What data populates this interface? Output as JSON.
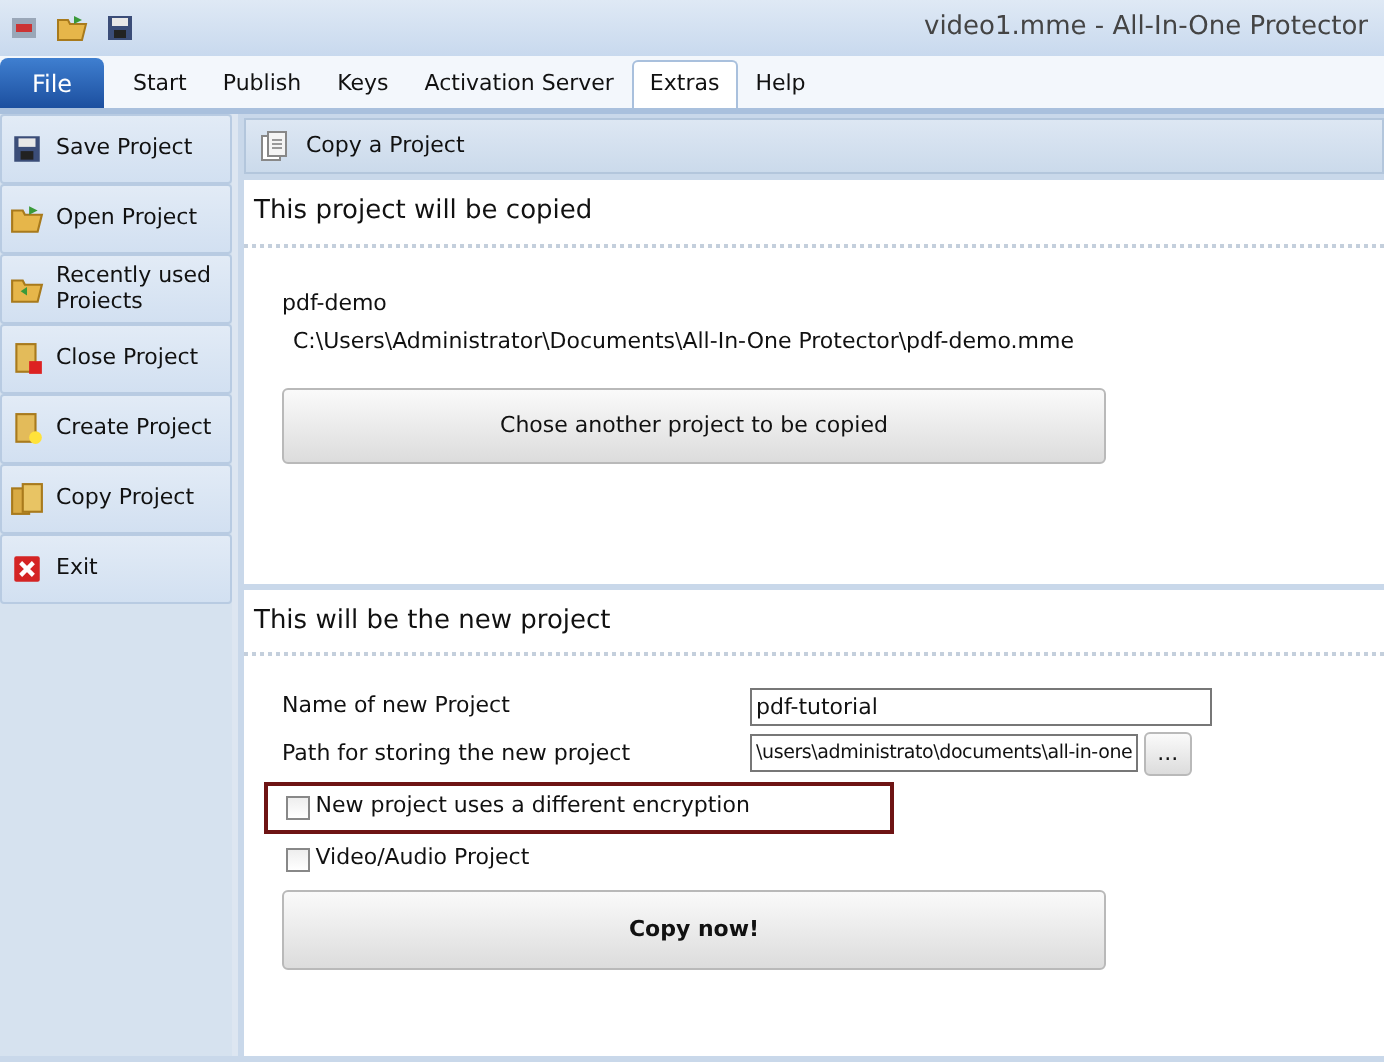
{
  "window": {
    "title": "video1.mme - All-In-One Protector"
  },
  "file_button": {
    "label": "File"
  },
  "tabs": [
    {
      "label": "Start",
      "selected": false
    },
    {
      "label": "Publish",
      "selected": false
    },
    {
      "label": "Keys",
      "selected": false
    },
    {
      "label": "Activation Server",
      "selected": false
    },
    {
      "label": "Extras",
      "selected": true
    },
    {
      "label": "Help",
      "selected": false
    }
  ],
  "sidebar": {
    "items": [
      {
        "label": "Save Project",
        "kind": "save"
      },
      {
        "label": "Open Project",
        "kind": "open"
      },
      {
        "label": "Recently used Proiects",
        "kind": "recent"
      },
      {
        "label": "Close Project",
        "kind": "close"
      },
      {
        "label": "Create Project",
        "kind": "create"
      },
      {
        "label": "Copy Project",
        "kind": "copy"
      },
      {
        "label": "Exit",
        "kind": "exit"
      }
    ]
  },
  "panel": {
    "title": "Copy a Project",
    "source": {
      "heading": "This project will be copied",
      "name": "pdf-demo",
      "path": "C:\\Users\\Administrator\\Documents\\All-In-One Protector\\pdf-demo.mme",
      "button": "Chose another project to be copied"
    },
    "target": {
      "heading": "This will be the new project",
      "fields": [
        {
          "label": "Name of new Project",
          "value": "pdf-tutorial"
        },
        {
          "label": "Path for storing the new project",
          "value": "\\users\\administrato\\documents\\all-in-one",
          "browse": "..."
        }
      ],
      "options": [
        {
          "label": "New project uses a different encryption",
          "checked": false,
          "highlighted": true
        },
        {
          "label": "Video/Audio Project",
          "checked": false,
          "highlighted": false
        }
      ],
      "button": "Copy now!"
    }
  }
}
